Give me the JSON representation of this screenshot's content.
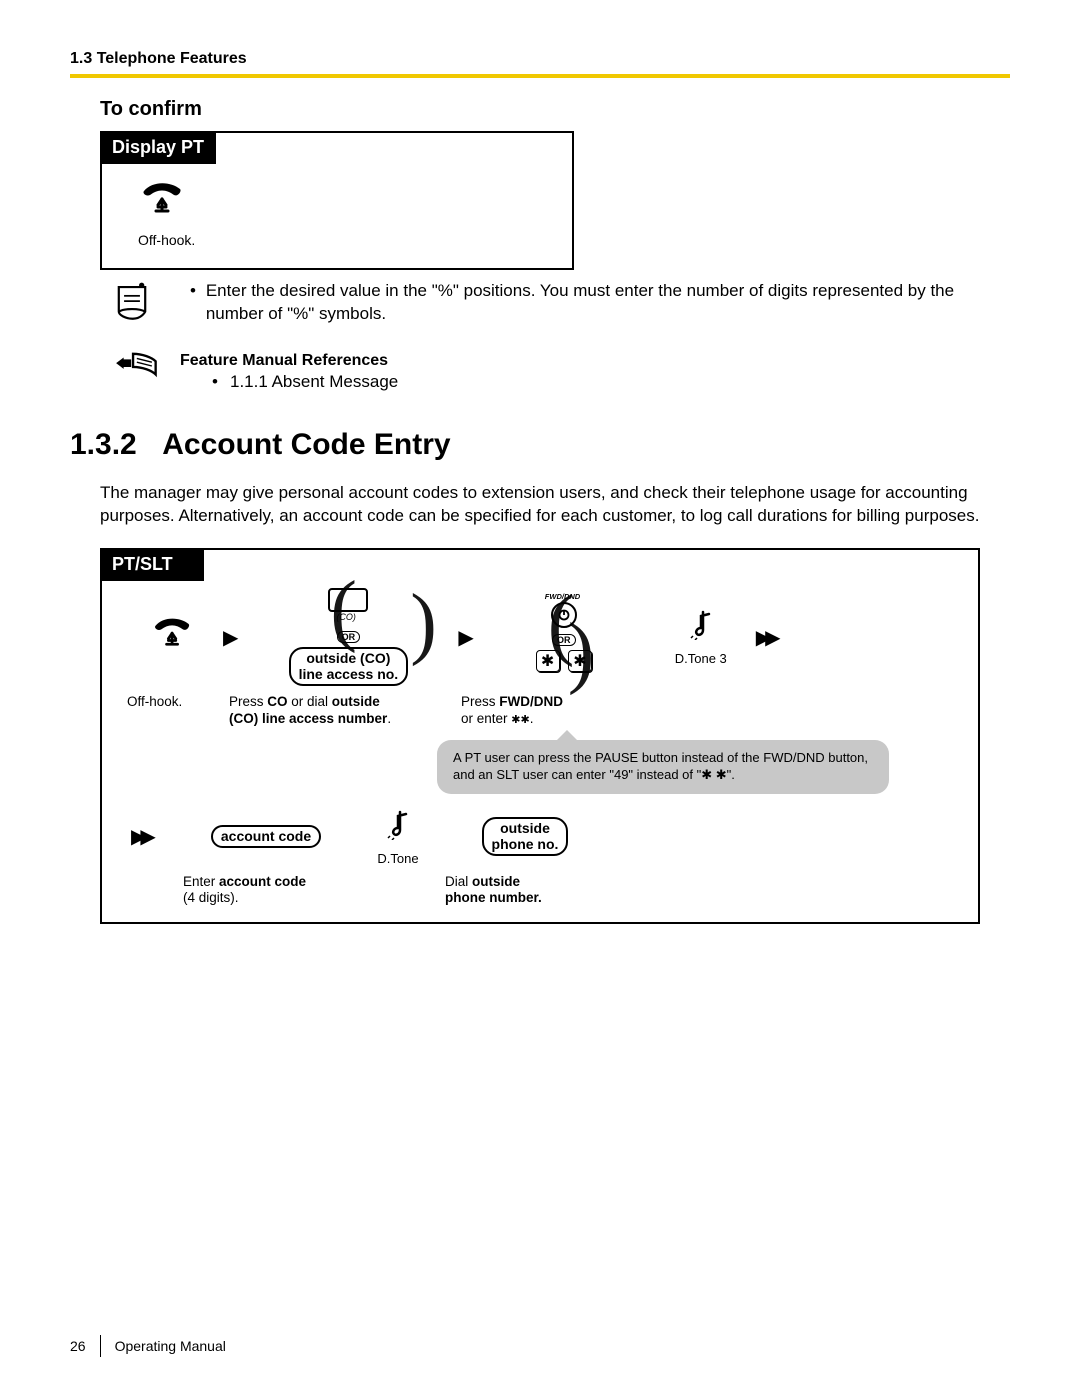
{
  "header": {
    "section": "1.3 Telephone Features"
  },
  "s1": {
    "title": "To confirm",
    "box_label": "Display PT",
    "offhook_caption": "Off-hook."
  },
  "note": {
    "text": "Enter the desired value in the \"%\" positions. You must enter the number of digits represented by the number of \"%\" symbols."
  },
  "ref": {
    "heading": "Feature Manual References",
    "item": "1.1.1 Absent Message"
  },
  "h1": {
    "num": "1.3.2",
    "title": "Account Code Entry"
  },
  "para": "The manager may give personal account codes to extension users, and check their telephone usage for accounting purposes. Alternatively, an account code can be specified for each customer, to log call durations for billing purposes.",
  "proc2": {
    "tab": "PT/SLT",
    "offhook_caption": "Off-hook.",
    "or": "OR",
    "pill_co_line1": "outside (CO)",
    "pill_co_line2": "line access no.",
    "cap_co_1": "Press ",
    "cap_co_bold1": "CO",
    "cap_co_2": " or dial ",
    "cap_co_bold2": "outside ",
    "cap_co_bold3": "CO) line access number",
    "cap_co_3": ".",
    "star": "✱",
    "cap_fwd_1": "Press ",
    "cap_fwd_bold": "FWD/DND",
    "cap_fwd_2": "or enter ",
    "cap_fwd_3": ".",
    "dtone3": "D.Tone 3",
    "bubble": "A PT user can press the PAUSE button instead of the FWD/DND button, and an SLT user can enter \"49\" instead of \"✱ ✱\".",
    "pill_acct": "account code",
    "cap_acct_1": "Enter ",
    "cap_acct_bold": "account code",
    "cap_acct_2": "(4 digits).",
    "dtone": "D.Tone",
    "pill_out_line1": "outside",
    "pill_out_line2": "phone no.",
    "cap_out_1": "Dial ",
    "cap_out_bold1": "outside",
    "cap_out_bold2": "phone number.",
    "fwd_label": "FWD/DND"
  },
  "footer": {
    "page": "26",
    "doc": "Operating Manual"
  }
}
